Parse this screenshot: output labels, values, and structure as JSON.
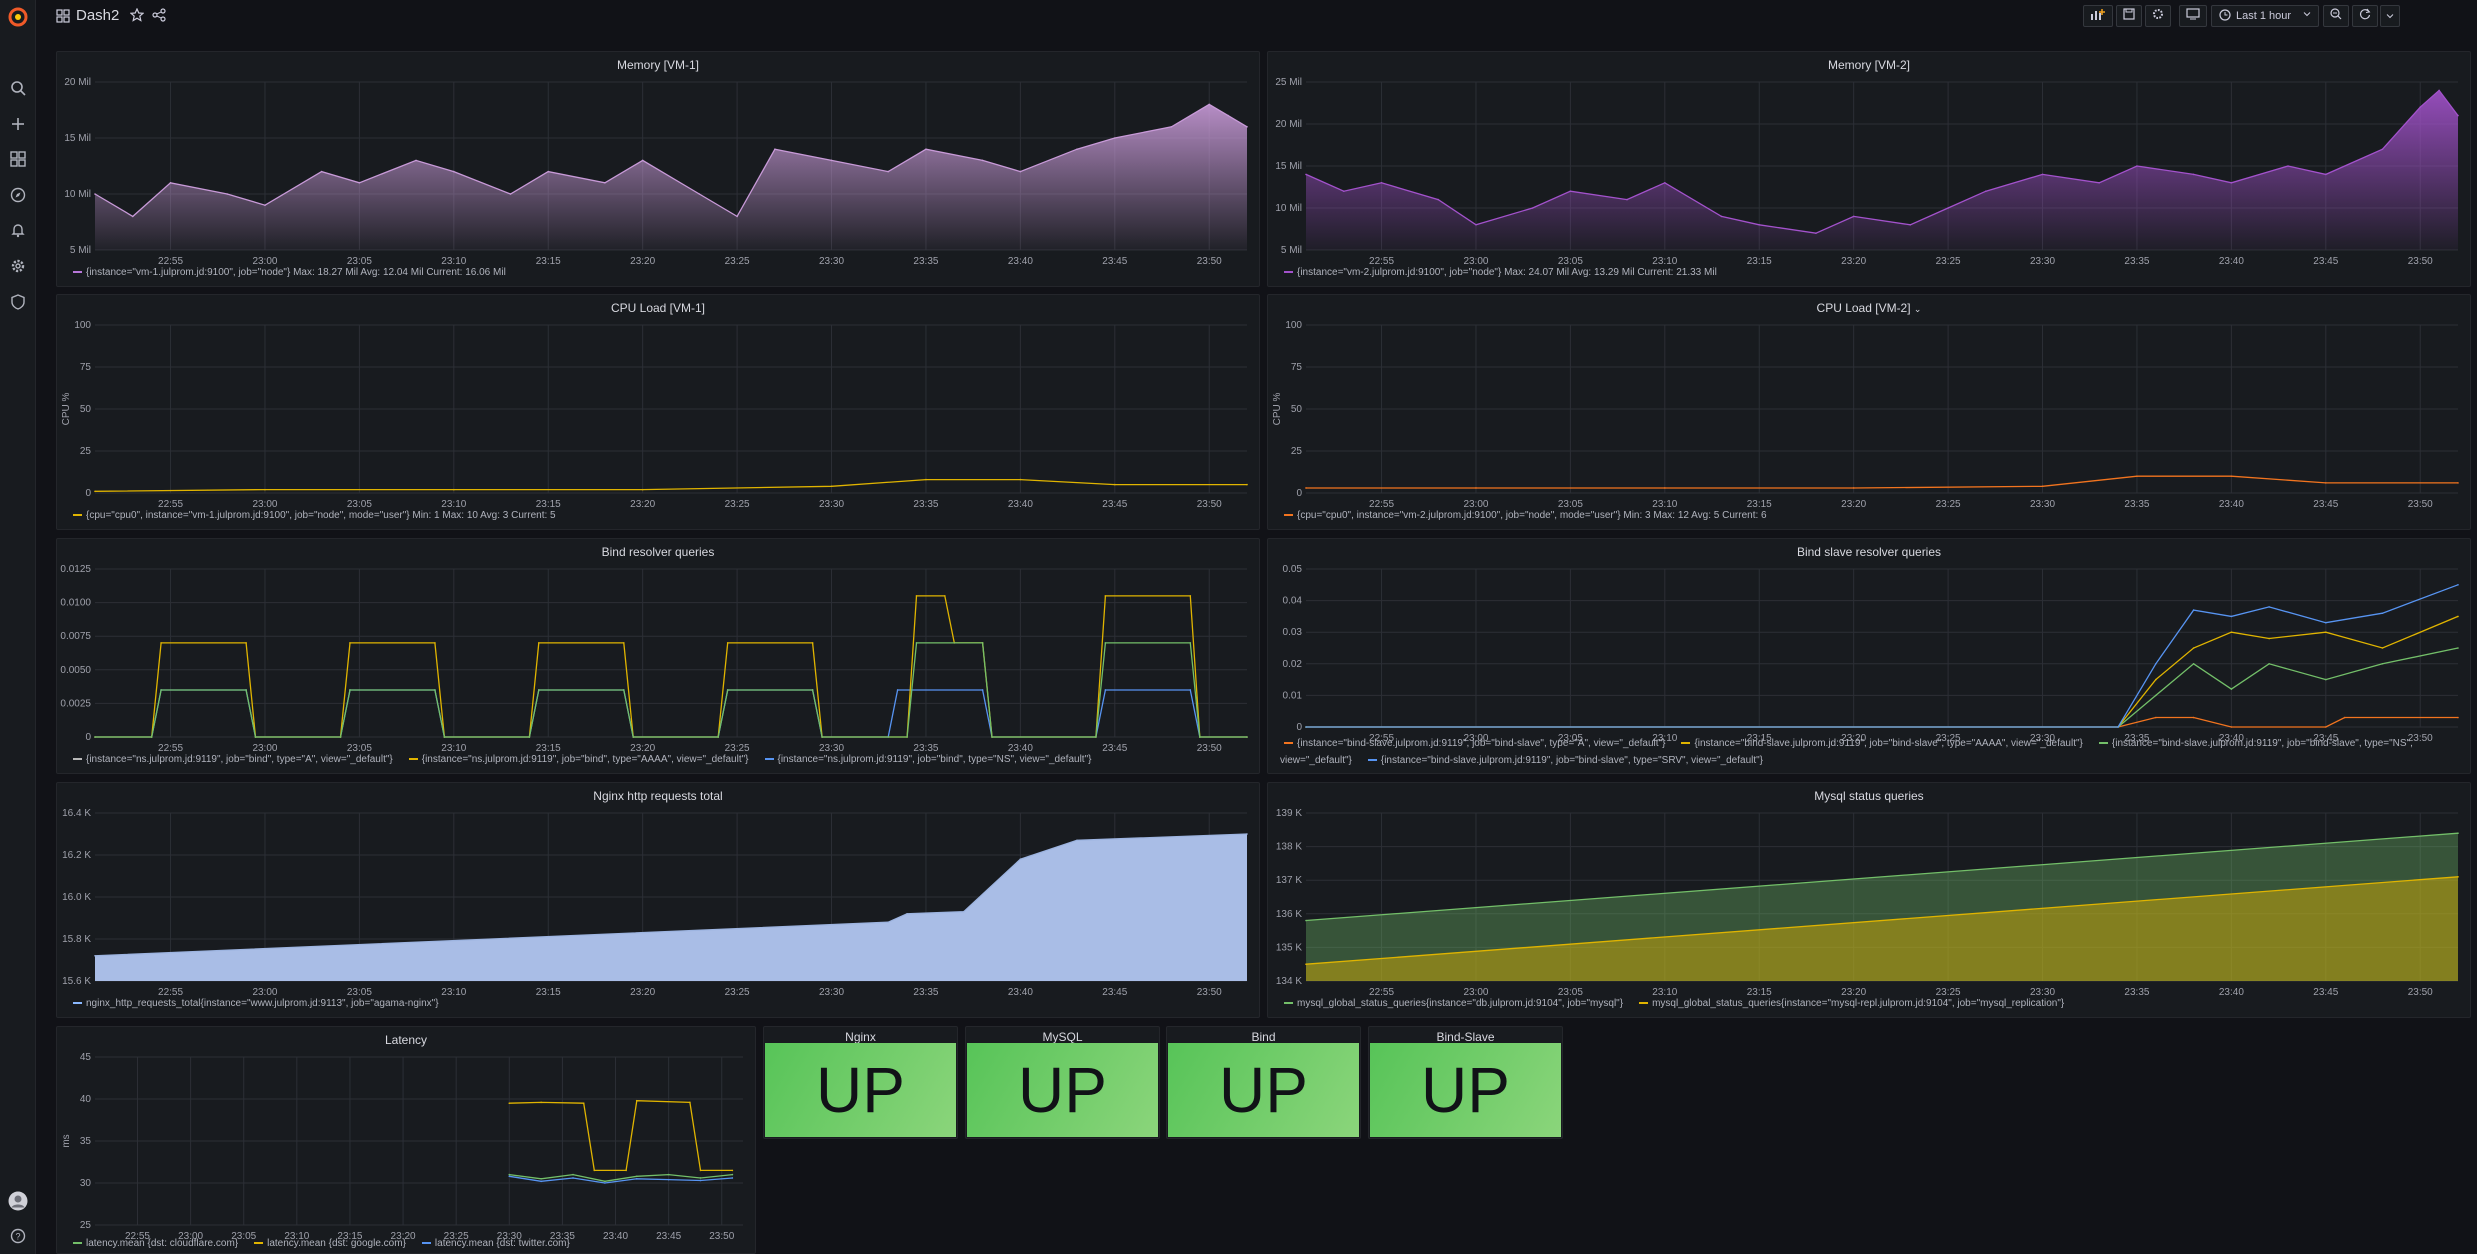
{
  "app": {
    "title": "Dash2",
    "time_range": "Last 1 hour"
  },
  "colors": {
    "bg": "#111217",
    "panel": "#181b1f",
    "grid": "#2c2f36",
    "axis": "#9fa1ab",
    "up": "#5ec45a"
  },
  "sidebar": {
    "items": [
      "grafana-logo",
      "search-icon",
      "plus-icon",
      "dashboards-icon",
      "compass-icon",
      "bell-icon",
      "gear-icon",
      "shield-icon",
      "avatar",
      "help-icon"
    ]
  },
  "times": [
    "22:55",
    "23:00",
    "23:05",
    "23:10",
    "23:15",
    "23:20",
    "23:25",
    "23:30",
    "23:35",
    "23:40",
    "23:45",
    "23:50"
  ],
  "panels": {
    "mem1": {
      "title": "Memory [VM-1]",
      "legend": [
        {
          "color": "#b877d9",
          "text": "{instance=\"vm-1.julprom.jd:9100\", job=\"node\"}  Max: 18.27 Mil  Avg: 12.04 Mil  Current: 16.06 Mil"
        }
      ]
    },
    "mem2": {
      "title": "Memory [VM-2]",
      "legend": [
        {
          "color": "#a352cc",
          "text": "{instance=\"vm-2.julprom.jd:9100\", job=\"node\"}  Max: 24.07 Mil  Avg: 13.29 Mil  Current: 21.33 Mil"
        }
      ]
    },
    "cpu1": {
      "title": "CPU Load [VM-1]",
      "legend": [
        {
          "color": "#e0b400",
          "text": "{cpu=\"cpu0\", instance=\"vm-1.julprom.jd:9100\", job=\"node\", mode=\"user\"}  Min: 1  Max: 10  Avg: 3  Current: 5"
        }
      ]
    },
    "cpu2": {
      "title": "CPU Load [VM-2]",
      "legend": [
        {
          "color": "#f2741f",
          "text": "{cpu=\"cpu0\", instance=\"vm-2.julprom.jd:9100\", job=\"node\", mode=\"user\"}  Min: 3  Max: 12  Avg: 5  Current: 6"
        }
      ]
    },
    "bind": {
      "title": "Bind resolver queries",
      "legend": [
        {
          "color": "#b8b8b8",
          "text": "{instance=\"ns.julprom.jd:9119\", job=\"bind\", type=\"A\", view=\"_default\"}"
        },
        {
          "color": "#e0b400",
          "text": "{instance=\"ns.julprom.jd:9119\", job=\"bind\", type=\"AAAA\", view=\"_default\"}"
        },
        {
          "color": "#5794f2",
          "text": "{instance=\"ns.julprom.jd:9119\", job=\"bind\", type=\"NS\", view=\"_default\"}"
        }
      ]
    },
    "bindslave": {
      "title": "Bind slave resolver queries",
      "legend": [
        {
          "color": "#f2741f",
          "text": "{instance=\"bind-slave.julprom.jd:9119\", job=\"bind-slave\", type=\"A\", view=\"_default\"}"
        },
        {
          "color": "#e0b400",
          "text": "{instance=\"bind-slave.julprom.jd:9119\", job=\"bind-slave\", type=\"AAAA\", view=\"_default\"}"
        },
        {
          "color": "#73bf69",
          "text": "{instance=\"bind-slave.julprom.jd:9119\", job=\"bind-slave\", type=\"NS\", view=\"_default\"}"
        },
        {
          "color": "#5794f2",
          "text": "{instance=\"bind-slave.julprom.jd:9119\", job=\"bind-slave\", type=\"SRV\", view=\"_default\"}"
        }
      ]
    },
    "nginx": {
      "title": "Nginx http requests total",
      "legend": [
        {
          "color": "#8ab8ff",
          "text": "nginx_http_requests_total{instance=\"www.julprom.jd:9113\", job=\"agama-nginx\"}"
        }
      ]
    },
    "mysql": {
      "title": "Mysql status queries",
      "legend": [
        {
          "color": "#73bf69",
          "text": "mysql_global_status_queries{instance=\"db.julprom.jd:9104\", job=\"mysql\"}"
        },
        {
          "color": "#e0b400",
          "text": "mysql_global_status_queries{instance=\"mysql-repl.julprom.jd:9104\", job=\"mysql_replication\"}"
        }
      ]
    },
    "latency": {
      "title": "Latency",
      "legend": [
        {
          "color": "#73bf69",
          "text": "latency.mean {dst: cloudflare.com}"
        },
        {
          "color": "#e0b400",
          "text": "latency.mean {dst: google.com}"
        },
        {
          "color": "#5794f2",
          "text": "latency.mean {dst: twitter.com}"
        }
      ]
    }
  },
  "stats": [
    {
      "title": "Nginx",
      "value": "UP"
    },
    {
      "title": "MySQL",
      "value": "UP"
    },
    {
      "title": "Bind",
      "value": "UP"
    },
    {
      "title": "Bind-Slave",
      "value": "UP"
    }
  ],
  "chart_data": [
    {
      "id": "mem1",
      "type": "area",
      "title": "Memory [VM-1]",
      "ylabel": "",
      "yticks": [
        "5 Mil",
        "10 Mil",
        "15 Mil",
        "20 Mil"
      ],
      "ylim": [
        5,
        20
      ],
      "unit": "Mil",
      "xlim": [
        "22:51",
        "23:52"
      ],
      "series": [
        {
          "name": "{instance=\"vm-1.julprom.jd:9100\", job=\"node\"}",
          "x": [
            "22:51",
            "22:53",
            "22:55",
            "22:58",
            "23:00",
            "23:03",
            "23:05",
            "23:08",
            "23:10",
            "23:13",
            "23:15",
            "23:18",
            "23:20",
            "23:23",
            "23:25",
            "23:27",
            "23:30",
            "23:33",
            "23:35",
            "23:38",
            "23:40",
            "23:43",
            "23:45",
            "23:48",
            "23:50",
            "23:51",
            "23:52"
          ],
          "values": [
            10,
            8,
            11,
            10,
            9,
            12,
            11,
            13,
            12,
            10,
            12,
            11,
            13,
            10,
            8,
            14,
            13,
            12,
            14,
            13,
            12,
            14,
            15,
            16,
            18,
            17,
            16
          ]
        }
      ]
    },
    {
      "id": "mem2",
      "type": "area",
      "title": "Memory [VM-2]",
      "yticks": [
        "5 Mil",
        "10 Mil",
        "15 Mil",
        "20 Mil",
        "25 Mil"
      ],
      "ylim": [
        5,
        25
      ],
      "unit": "Mil",
      "xlim": [
        "22:51",
        "23:52"
      ],
      "series": [
        {
          "name": "{instance=\"vm-2.julprom.jd:9100\", job=\"node\"}",
          "x": [
            "22:51",
            "22:53",
            "22:55",
            "22:58",
            "23:00",
            "23:03",
            "23:05",
            "23:08",
            "23:10",
            "23:13",
            "23:15",
            "23:18",
            "23:20",
            "23:23",
            "23:25",
            "23:27",
            "23:30",
            "23:33",
            "23:35",
            "23:38",
            "23:40",
            "23:43",
            "23:45",
            "23:48",
            "23:50",
            "23:51",
            "23:52"
          ],
          "values": [
            14,
            12,
            13,
            11,
            8,
            10,
            12,
            11,
            13,
            9,
            8,
            7,
            9,
            8,
            10,
            12,
            14,
            13,
            15,
            14,
            13,
            15,
            14,
            17,
            22,
            24,
            21
          ]
        }
      ]
    },
    {
      "id": "cpu1",
      "type": "line",
      "title": "CPU Load [VM-1]",
      "ylabel": "CPU %",
      "yticks": [
        "0",
        "25",
        "50",
        "75",
        "100"
      ],
      "ylim": [
        0,
        100
      ],
      "xlim": [
        "22:51",
        "23:52"
      ],
      "series": [
        {
          "name": "cpu0",
          "x": [
            "22:51",
            "23:00",
            "23:10",
            "23:20",
            "23:30",
            "23:35",
            "23:40",
            "23:45",
            "23:52"
          ],
          "values": [
            1,
            2,
            2,
            2,
            4,
            8,
            8,
            5,
            5
          ]
        }
      ]
    },
    {
      "id": "cpu2",
      "type": "line",
      "title": "CPU Load [VM-2]",
      "ylabel": "CPU %",
      "yticks": [
        "0",
        "25",
        "50",
        "75",
        "100"
      ],
      "ylim": [
        0,
        100
      ],
      "xlim": [
        "22:51",
        "23:52"
      ],
      "series": [
        {
          "name": "cpu0",
          "x": [
            "22:51",
            "23:00",
            "23:10",
            "23:20",
            "23:30",
            "23:35",
            "23:40",
            "23:45",
            "23:52"
          ],
          "values": [
            3,
            3,
            3,
            3,
            4,
            10,
            10,
            6,
            6
          ]
        }
      ]
    },
    {
      "id": "bind",
      "type": "line",
      "title": "Bind resolver queries",
      "yticks": [
        "0",
        "0.0025",
        "0.0050",
        "0.0075",
        "0.0100",
        "0.0125"
      ],
      "ylim": [
        0,
        0.0125
      ],
      "xlim": [
        "22:51",
        "23:52"
      ],
      "series": [
        {
          "name": "type=\"A\"",
          "x": [
            "22:51",
            "22:54",
            "22:54.5",
            "22:59",
            "22:59.5",
            "23:04",
            "23:04.5",
            "23:09",
            "23:09.5",
            "23:14",
            "23:14.5",
            "23:19",
            "23:19.5",
            "23:24",
            "23:24.5",
            "23:29",
            "23:29.5",
            "23:33",
            "23:33.5",
            "23:38",
            "23:38.5",
            "23:44",
            "23:44.5",
            "23:49",
            "23:49.5",
            "23:52"
          ],
          "values": [
            0,
            0,
            0.0035,
            0.0035,
            0,
            0,
            0.0035,
            0.0035,
            0,
            0,
            0.0035,
            0.0035,
            0,
            0,
            0.0035,
            0.0035,
            0,
            0,
            0.0035,
            0.0035,
            0,
            0,
            0.0035,
            0.0035,
            0,
            0
          ]
        },
        {
          "name": "type=\"AAAA\"",
          "x": [
            "22:51",
            "22:54",
            "22:54.5",
            "22:59",
            "22:59.5",
            "23:04",
            "23:04.5",
            "23:09",
            "23:09.5",
            "23:14",
            "23:14.5",
            "23:19",
            "23:19.5",
            "23:24",
            "23:24.5",
            "23:29",
            "23:29.5",
            "23:34",
            "23:34.5",
            "23:36",
            "23:36.5",
            "23:38",
            "23:38.5",
            "23:44",
            "23:44.5",
            "23:49",
            "23:49.5",
            "23:52"
          ],
          "values": [
            0,
            0,
            0.007,
            0.007,
            0,
            0,
            0.007,
            0.007,
            0,
            0,
            0.007,
            0.007,
            0,
            0,
            0.007,
            0.007,
            0,
            0,
            0.0105,
            0.0105,
            0.007,
            0.007,
            0,
            0,
            0.0105,
            0.0105,
            0,
            0
          ]
        },
        {
          "name": "type=\"NS\"",
          "x": [
            "22:51",
            "22:54",
            "22:54.5",
            "22:59",
            "22:59.5",
            "23:04",
            "23:04.5",
            "23:09",
            "23:09.5",
            "23:14",
            "23:14.5",
            "23:19",
            "23:19.5",
            "23:24",
            "23:24.5",
            "23:29",
            "23:29.5",
            "23:34",
            "23:34.5",
            "23:38",
            "23:38.5",
            "23:44",
            "23:44.5",
            "23:49",
            "23:49.5",
            "23:52"
          ],
          "values": [
            0,
            0,
            0.0035,
            0.0035,
            0,
            0,
            0.0035,
            0.0035,
            0,
            0,
            0.0035,
            0.0035,
            0,
            0,
            0.0035,
            0.0035,
            0,
            0,
            0.007,
            0.007,
            0,
            0,
            0.007,
            0.007,
            0,
            0
          ]
        }
      ]
    },
    {
      "id": "bindslave",
      "type": "line",
      "title": "Bind slave resolver queries",
      "yticks": [
        "0",
        "0.01",
        "0.02",
        "0.03",
        "0.04",
        "0.05"
      ],
      "ylim": [
        0,
        0.05
      ],
      "xlim": [
        "22:51",
        "23:52"
      ],
      "series": [
        {
          "name": "type=\"A\"",
          "x": [
            "22:51",
            "23:34",
            "23:36",
            "23:38",
            "23:40",
            "23:45",
            "23:46",
            "23:52"
          ],
          "values": [
            0,
            0,
            0.003,
            0.003,
            0,
            0,
            0.003,
            0.003
          ]
        },
        {
          "name": "type=\"AAAA\"",
          "x": [
            "22:51",
            "23:34",
            "23:36",
            "23:38",
            "23:40",
            "23:42",
            "23:45",
            "23:48",
            "23:52"
          ],
          "values": [
            0,
            0,
            0.015,
            0.025,
            0.03,
            0.028,
            0.03,
            0.025,
            0.035
          ]
        },
        {
          "name": "type=\"NS\"",
          "x": [
            "22:51",
            "23:34",
            "23:36",
            "23:38",
            "23:40",
            "23:42",
            "23:45",
            "23:48",
            "23:52"
          ],
          "values": [
            0,
            0,
            0.01,
            0.02,
            0.012,
            0.02,
            0.015,
            0.02,
            0.025
          ]
        },
        {
          "name": "type=\"SRV\"",
          "x": [
            "22:51",
            "23:34",
            "23:36",
            "23:38",
            "23:40",
            "23:42",
            "23:45",
            "23:48",
            "23:52"
          ],
          "values": [
            0,
            0,
            0.02,
            0.037,
            0.035,
            0.038,
            0.033,
            0.036,
            0.045
          ]
        }
      ]
    },
    {
      "id": "nginx",
      "type": "area",
      "title": "Nginx http requests total",
      "yticks": [
        "15.6 K",
        "15.8 K",
        "16.0 K",
        "16.2 K",
        "16.4 K"
      ],
      "ylim": [
        15.6,
        16.4
      ],
      "unit": "K",
      "xlim": [
        "22:51",
        "23:52"
      ],
      "series": [
        {
          "name": "nginx_http_requests_total",
          "x": [
            "22:51",
            "23:33",
            "23:34",
            "23:37",
            "23:40",
            "23:43",
            "23:52"
          ],
          "values": [
            15.72,
            15.88,
            15.92,
            15.93,
            16.18,
            16.27,
            16.3
          ]
        }
      ]
    },
    {
      "id": "mysql",
      "type": "area",
      "title": "Mysql status queries",
      "yticks": [
        "134 K",
        "135 K",
        "136 K",
        "137 K",
        "138 K",
        "139 K"
      ],
      "ylim": [
        134,
        139
      ],
      "unit": "K",
      "xlim": [
        "22:51",
        "23:52"
      ],
      "series": [
        {
          "name": "db.julprom.jd:9104",
          "x": [
            "22:51",
            "23:52"
          ],
          "values": [
            135.8,
            138.4
          ]
        },
        {
          "name": "mysql-repl.julprom.jd:9104",
          "x": [
            "22:51",
            "23:52"
          ],
          "values": [
            134.5,
            137.1
          ]
        }
      ]
    },
    {
      "id": "latency",
      "type": "line",
      "title": "Latency",
      "ylabel": "ms",
      "yticks": [
        "25",
        "30",
        "35",
        "40",
        "45"
      ],
      "ylim": [
        25,
        45
      ],
      "xlim": [
        "22:51",
        "23:52"
      ],
      "series": [
        {
          "name": "latency.mean {dst: cloudflare.com}",
          "x": [
            "23:30",
            "23:33",
            "23:36",
            "23:39",
            "23:42",
            "23:45",
            "23:48",
            "23:51"
          ],
          "values": [
            31,
            30.5,
            31,
            30.2,
            30.8,
            31,
            30.6,
            31
          ]
        },
        {
          "name": "latency.mean {dst: google.com}",
          "x": [
            "23:30",
            "23:33",
            "23:37",
            "23:38",
            "23:41",
            "23:42",
            "23:47",
            "23:48",
            "23:51"
          ],
          "values": [
            39.5,
            39.6,
            39.5,
            31.5,
            31.5,
            39.8,
            39.6,
            31.5,
            31.5
          ]
        },
        {
          "name": "latency.mean {dst: twitter.com}",
          "x": [
            "23:30",
            "23:33",
            "23:36",
            "23:39",
            "23:42",
            "23:45",
            "23:48",
            "23:51"
          ],
          "values": [
            30.8,
            30.2,
            30.6,
            30.0,
            30.5,
            30.4,
            30.3,
            30.6
          ]
        }
      ]
    }
  ]
}
